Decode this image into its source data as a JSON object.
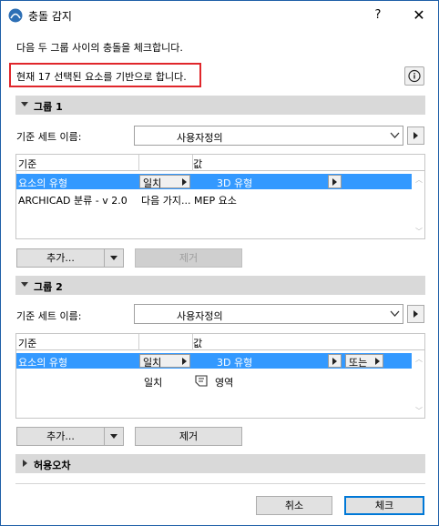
{
  "window": {
    "title": "충돌 감지",
    "help_glyph": "?",
    "close_glyph": "✕"
  },
  "intro_text": "다음 두 그룹 사이의 충돌을 체크합니다.",
  "selection_text": "현재 17 선택된 요소를 기반으로 합니다.",
  "group1": {
    "header": "그룹 1",
    "set_name_label": "기준 세트 이름:",
    "set_name_value": "사용자정의",
    "col_criteria": "기준",
    "col_value": "값",
    "rows": [
      {
        "criteria": "요소의 유형",
        "operator": "일치",
        "value": "3D 유형"
      },
      {
        "criteria": "ARCHICAD 분류 - v 2.0",
        "operator": "다음 가지...",
        "value": "MEP 요소"
      }
    ],
    "add_label": "추가...",
    "remove_label": "제거"
  },
  "group2": {
    "header": "그룹 2",
    "set_name_label": "기준 세트 이름:",
    "set_name_value": "사용자정의",
    "col_criteria": "기준",
    "col_value": "값",
    "rows": [
      {
        "criteria": "요소의 유형",
        "operator": "일치",
        "value": "3D 유형",
        "logic": "또는"
      },
      {
        "criteria": "",
        "operator": "일치",
        "value": "영역"
      }
    ],
    "add_label": "추가...",
    "remove_label": "제거"
  },
  "tolerance_header": "허용오차",
  "footer": {
    "cancel_label": "취소",
    "check_label": "체크"
  },
  "colors": {
    "selection": "#3399ff",
    "highlight_box": "#e0262b",
    "section_bg": "#d9d9d9"
  }
}
